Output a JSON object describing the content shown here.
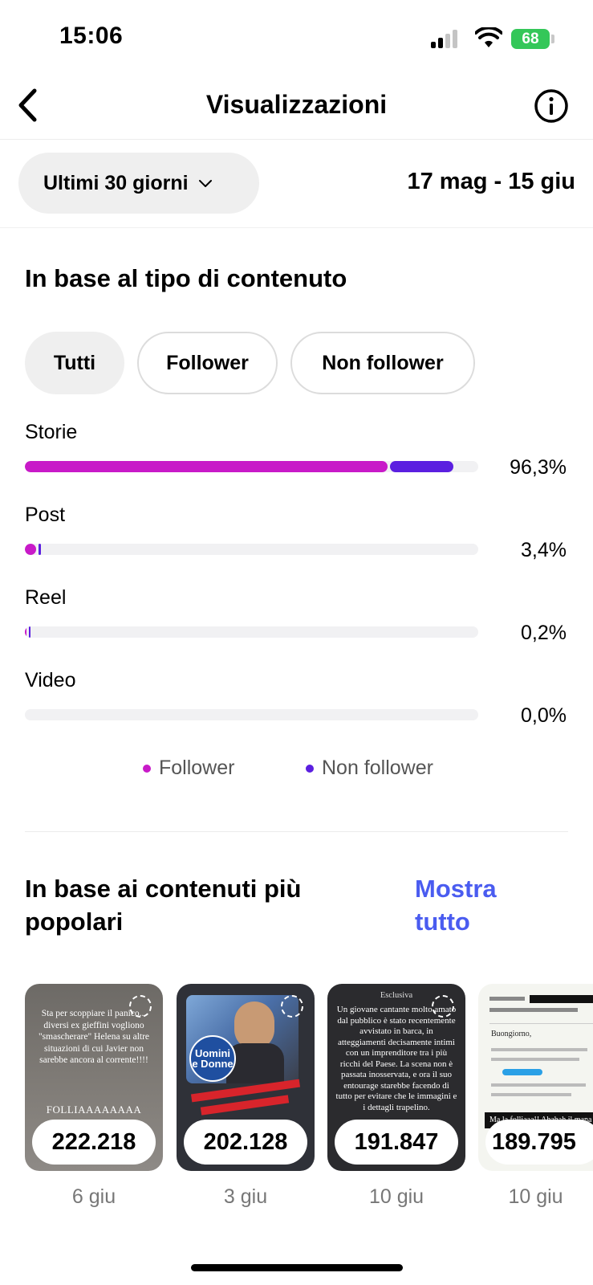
{
  "status_bar": {
    "time": "15:06",
    "battery": "68"
  },
  "header": {
    "title": "Visualizzazioni"
  },
  "filters": {
    "period": "Ultimi 30 giorni",
    "date_range": "17 mag - 15 giu"
  },
  "content_type": {
    "title": "In base al tipo di contenuto",
    "chips": [
      "Tutti",
      "Follower",
      "Non follower"
    ],
    "rows": [
      {
        "label": "Storie",
        "percent": "96,3%",
        "follower_share": 0.8,
        "non_follower_share": 0.14
      },
      {
        "label": "Post",
        "percent": "3,4%",
        "follower_share": 0.024,
        "non_follower_share": 0.006
      },
      {
        "label": "Reel",
        "percent": "0,2%",
        "follower_share": 0.002,
        "non_follower_share": 0.002
      },
      {
        "label": "Video",
        "percent": "0,0%",
        "follower_share": 0,
        "non_follower_share": 0
      }
    ],
    "legend": [
      {
        "label": "Follower",
        "color": "#c81ac8"
      },
      {
        "label": "Non follower",
        "color": "#5b1fe0"
      }
    ]
  },
  "popular": {
    "title_line1": "In base ai contenuti più",
    "title_line2": "popolari",
    "show_all_line1": "Mostra",
    "show_all_line2": "tutto",
    "cards": [
      {
        "views": "222.218",
        "date": "6 giu",
        "text": "Sta per scoppiare il panico... diversi ex gieffini vogliono \"smascherare\" Helena su altre situazioni di cui Javier non sarebbe ancora al corrente!!!!",
        "text2": "FOLLIAAAAAAAA"
      },
      {
        "views": "202.128",
        "date": "3 giu",
        "overlay": "Uomini e Donne"
      },
      {
        "views": "191.847",
        "date": "10 giu",
        "kicker": "Esclusiva",
        "text": "Un giovane cantante molto amato dal pubblico è stato recentemente avvistato in barca, in atteggiamenti decisamente intimi con un imprenditore tra i più ricchi del Paese. La scena non è passata inosservata, e ora il suo entourage starebbe facendo di tutto per evitare che le immagini e i dettagli trapelino."
      },
      {
        "views": "189.795",
        "date": "10 giu",
        "text": "Buongiorno,",
        "text2": "Ma la folliaaa!! Ahahah il mana"
      }
    ]
  }
}
